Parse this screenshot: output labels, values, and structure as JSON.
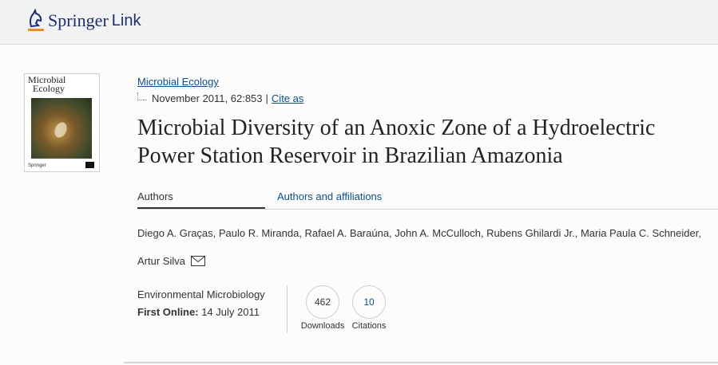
{
  "header": {
    "brand": "Springer",
    "brand_suffix": "Link"
  },
  "cover": {
    "title_line1": "Microbial",
    "title_line2": "Ecology",
    "publisher": "Springer"
  },
  "article": {
    "journal": "Microbial Ecology",
    "date_volume": "November 2011, 62:853",
    "separator": "|",
    "cite_label": "Cite as",
    "title": "Microbial Diversity of an Anoxic Zone of a Hydroelectric Power Station Reservoir in Brazilian Amazonia"
  },
  "tabs": [
    {
      "label": "Authors"
    },
    {
      "label": "Authors and affiliations"
    }
  ],
  "authors": {
    "line1": "Diego A. Graças, Paulo R. Miranda, Rafael A. Baraúna, John A. McCulloch, Rubens Ghilardi Jr., Maria Paula C. Schneider,",
    "line2": "Artur Silva"
  },
  "info": {
    "category": "Environmental Microbiology",
    "first_online_label": "First Online:",
    "first_online_value": "14 July 2011"
  },
  "metrics": {
    "downloads_value": "462",
    "downloads_label": "Downloads",
    "citations_value": "10",
    "citations_label": "Citations"
  },
  "colors": {
    "link": "#0c4f8a",
    "brand": "#1d2f6b",
    "brand_accent": "#f08a24"
  }
}
